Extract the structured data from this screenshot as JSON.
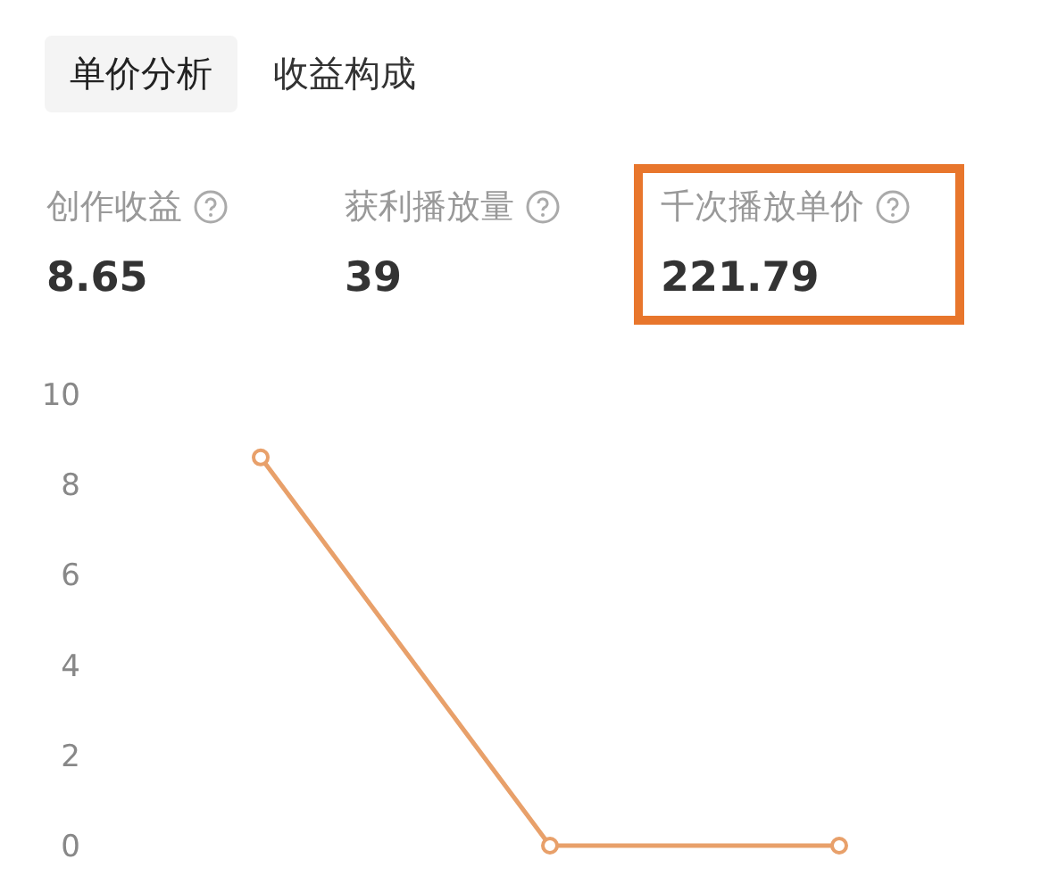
{
  "tabs": [
    {
      "label": "单价分析",
      "selected": true
    },
    {
      "label": "收益构成",
      "selected": false
    }
  ],
  "metrics": [
    {
      "label": "创作收益",
      "value": "8.65",
      "highlighted": false
    },
    {
      "label": "获利播放量",
      "value": "39",
      "highlighted": false
    },
    {
      "label": "千次播放单价",
      "value": "221.79",
      "highlighted": true
    }
  ],
  "chart_data": {
    "type": "line",
    "ylim": [
      0,
      10
    ],
    "yticks": [
      0,
      2,
      4,
      6,
      8,
      10
    ],
    "series": [
      {
        "color": "#e8a06a",
        "marker": "circle",
        "values": [
          8.6,
          0,
          0
        ]
      }
    ]
  }
}
